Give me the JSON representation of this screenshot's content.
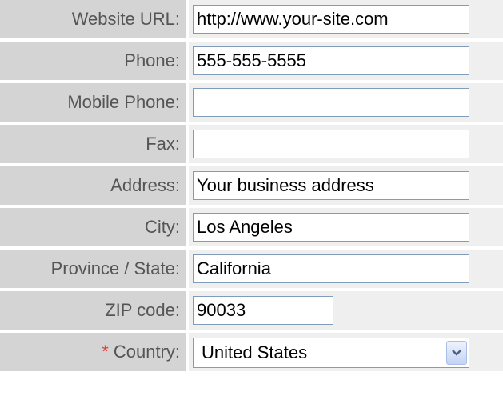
{
  "form": {
    "rows": [
      {
        "label": "Website URL:",
        "value": "http://www.your-site.com"
      },
      {
        "label": "Phone:",
        "value": "555-555-5555"
      },
      {
        "label": "Mobile Phone:",
        "value": ""
      },
      {
        "label": "Fax:",
        "value": ""
      },
      {
        "label": "Address:",
        "value": "Your business address"
      },
      {
        "label": "City:",
        "value": "Los Angeles"
      },
      {
        "label": "Province / State:",
        "value": "California"
      },
      {
        "label": "ZIP code:",
        "value": "90033"
      }
    ],
    "country": {
      "required_marker": "*",
      "label": "Country:",
      "selected": "United States",
      "icon": "chevron-down-icon"
    }
  },
  "colors": {
    "label_bg": "#d4d4d4",
    "field_bg": "#efefef",
    "label_text": "#555555",
    "input_border": "#7f9db9",
    "required": "#e04040"
  }
}
